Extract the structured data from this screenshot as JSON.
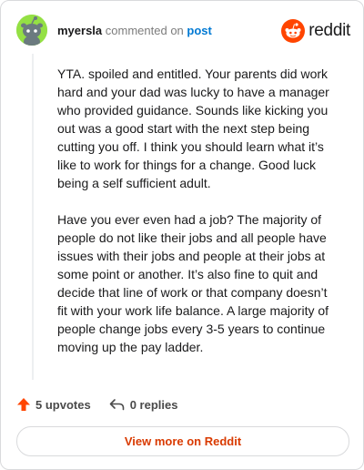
{
  "header": {
    "username": "myersla",
    "action_text": "commented on",
    "post_link": "post",
    "brand": "reddit"
  },
  "comment": {
    "paragraphs": [
      "YTA. spoiled and entitled. Your parents did work hard and your dad was lucky to have a manager who provided guidance. Sounds like kicking you out was a good start with the next step being cutting you off. I think you should learn what it’s like to work for things for a change. Good luck being a self sufficient adult.",
      "Have you ever even had a job? The majority of people do not like their jobs and all people have issues with their jobs and people at their jobs at some point or another. It’s also fine to quit and decide that line of work or that company doesn’t fit with your work life balance. A large majority of people change jobs every 3-5 years to continue moving up the pay ladder."
    ]
  },
  "actions": {
    "upvotes": "5 upvotes",
    "replies": "0 replies"
  },
  "footer": {
    "view_more": "View more on Reddit"
  },
  "colors": {
    "accent": "#ff4500",
    "link": "#0079d3",
    "avatar_bg": "#94e044"
  },
  "icons": {
    "avatar": "snoo-avatar-icon",
    "logo": "reddit-snoo-icon",
    "upvote": "upvote-arrow-icon",
    "reply": "reply-arrow-icon"
  }
}
